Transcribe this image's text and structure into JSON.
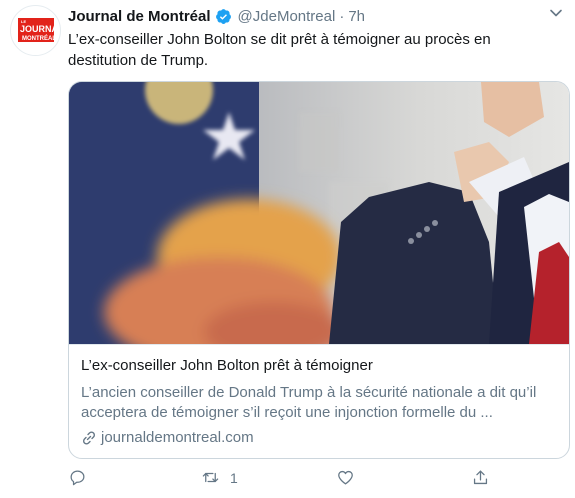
{
  "tweet": {
    "author_name": "Journal de Montréal",
    "handle": "@JdeMontreal",
    "separator": "·",
    "time": "7h",
    "text": "L’ex-conseiller John Bolton se dit prêt à témoigner au procès en destitution de Trump.",
    "avatar_logo_text": [
      "LE",
      "JOURNAL",
      "DE",
      "MONTRÉAL"
    ]
  },
  "card": {
    "title": "L’ex-conseiller John Bolton prêt à témoigner",
    "description": "L’ancien conseiller de Donald Trump à la sécurité nationale a dit qu’il acceptera de témoigner s’il reçoit une injonction formelle du ...",
    "domain": "journaldemontreal.com"
  },
  "actions": {
    "reply_count": "",
    "retweet_count": "1",
    "like_count": "",
    "share_count": ""
  },
  "colors": {
    "brand_red": "#e2231a",
    "verified_blue": "#1da1f2",
    "secondary_text": "#657786"
  }
}
